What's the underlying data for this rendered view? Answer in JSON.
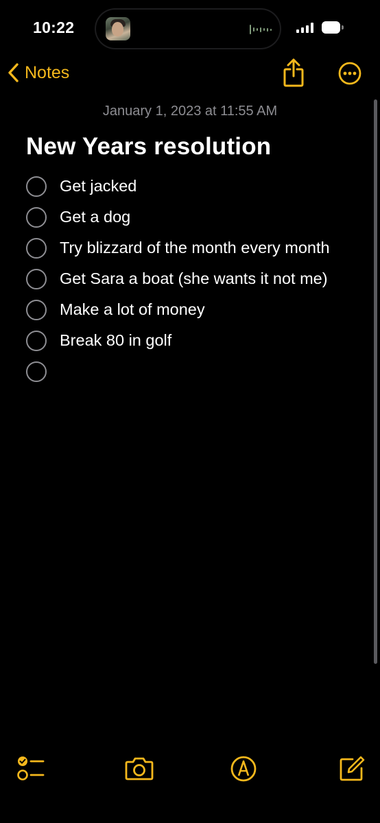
{
  "status_bar": {
    "time": "10:22",
    "icons": [
      "caller-avatar",
      "audio-waveform",
      "cellular-signal-icon",
      "battery-icon"
    ]
  },
  "nav": {
    "back_label": "Notes",
    "icons": [
      "chevron-left-icon",
      "share-icon",
      "more-icon"
    ]
  },
  "note": {
    "date": "January 1, 2023 at 11:55 AM",
    "title": "New Years resolution",
    "items": [
      {
        "text": "Get jacked",
        "checked": false
      },
      {
        "text": "Get a dog",
        "checked": false
      },
      {
        "text": "Try blizzard of the month every month",
        "checked": false
      },
      {
        "text": "Get Sara a boat (she wants it not me)",
        "checked": false
      },
      {
        "text": "Make a lot of money",
        "checked": false
      },
      {
        "text": "Break 80 in golf",
        "checked": false
      },
      {
        "text": "",
        "checked": false
      }
    ]
  },
  "toolbar": {
    "icons": [
      "checklist-icon",
      "camera-icon",
      "markup-icon",
      "compose-icon"
    ]
  },
  "colors": {
    "accent": "#f5b81c",
    "background": "#000000",
    "secondary_text": "#8d8d92",
    "checkbox_border": "#8e8e93"
  }
}
